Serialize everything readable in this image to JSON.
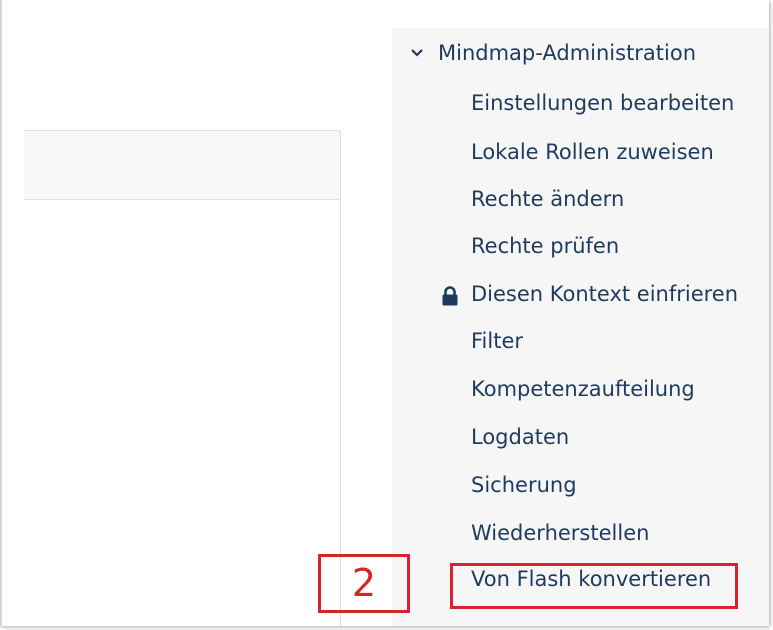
{
  "admin": {
    "title": "Mindmap-Administration",
    "items": [
      {
        "label": "Einstellungen bearbeiten"
      },
      {
        "label": "Lokale Rollen zuweisen"
      },
      {
        "label": "Rechte ändern"
      },
      {
        "label": "Rechte prüfen"
      },
      {
        "label": "Diesen Kontext einfrieren",
        "icon": "lock-icon"
      },
      {
        "label": "Filter"
      },
      {
        "label": "Kompetenzaufteilung"
      },
      {
        "label": "Logdaten"
      },
      {
        "label": "Sicherung"
      },
      {
        "label": "Wiederherstellen"
      },
      {
        "label": "Von Flash konvertieren"
      }
    ]
  },
  "annotation": {
    "number": "2",
    "color": "#d9232a"
  },
  "colors": {
    "link": "#1e3a5f",
    "panel_bg": "#f6f6f6"
  }
}
